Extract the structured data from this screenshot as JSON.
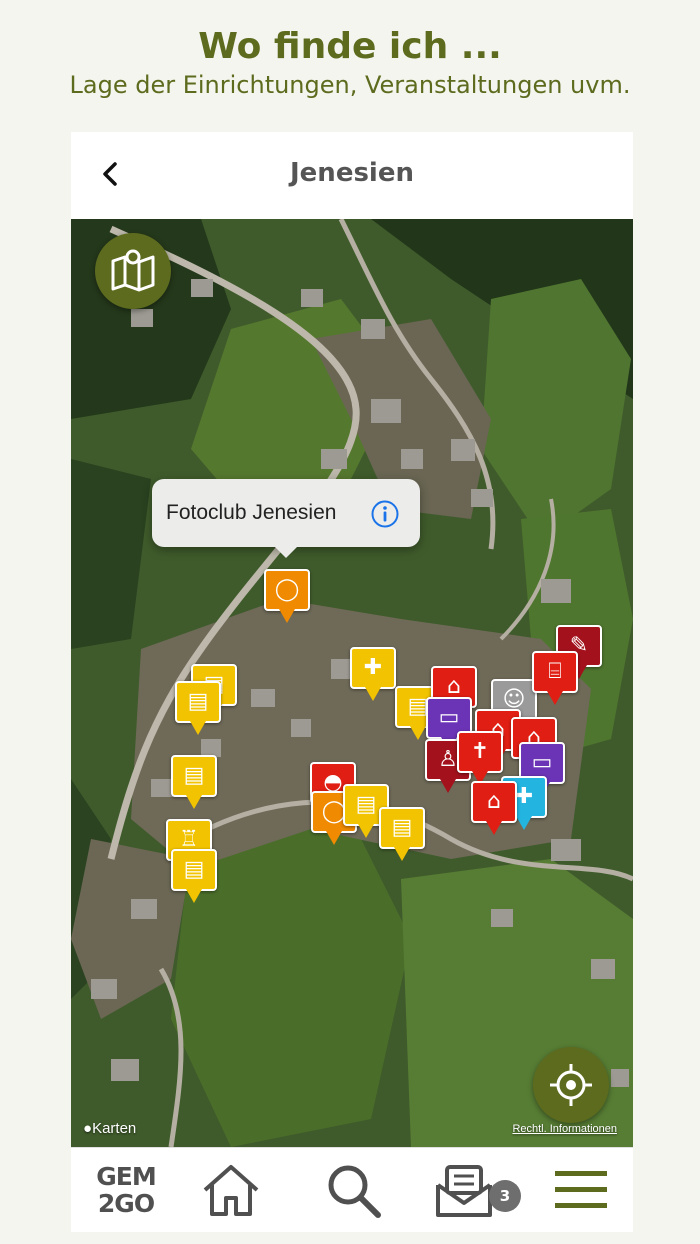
{
  "promo": {
    "title": "Wo finde ich ...",
    "subtitle": "Lage der Einrichtungen, Veranstaltungen uvm."
  },
  "header": {
    "title": "Jenesien",
    "back_icon": "chevron-left-icon"
  },
  "map": {
    "callout_label": "Fotoclub Jenesien",
    "attribution": "Karten",
    "legal_link": "Rechtl. Informationen",
    "layers_icon": "map-layers-icon",
    "locate_icon": "locate-me-icon"
  },
  "tabbar": {
    "logo_line1": "GEM",
    "logo_line2": "2GO",
    "home_icon": "home-icon",
    "search_icon": "search-icon",
    "messages_icon": "messages-icon",
    "messages_badge": "3",
    "menu_icon": "menu-icon"
  },
  "colors": {
    "brand_green": "#5d6b1e",
    "pin_yellow": "#f2c300",
    "pin_orange": "#f08a00",
    "pin_red": "#e01e14",
    "pin_darkred": "#a3121c",
    "pin_purple": "#6b33b5",
    "pin_cyan": "#23b5e0"
  }
}
